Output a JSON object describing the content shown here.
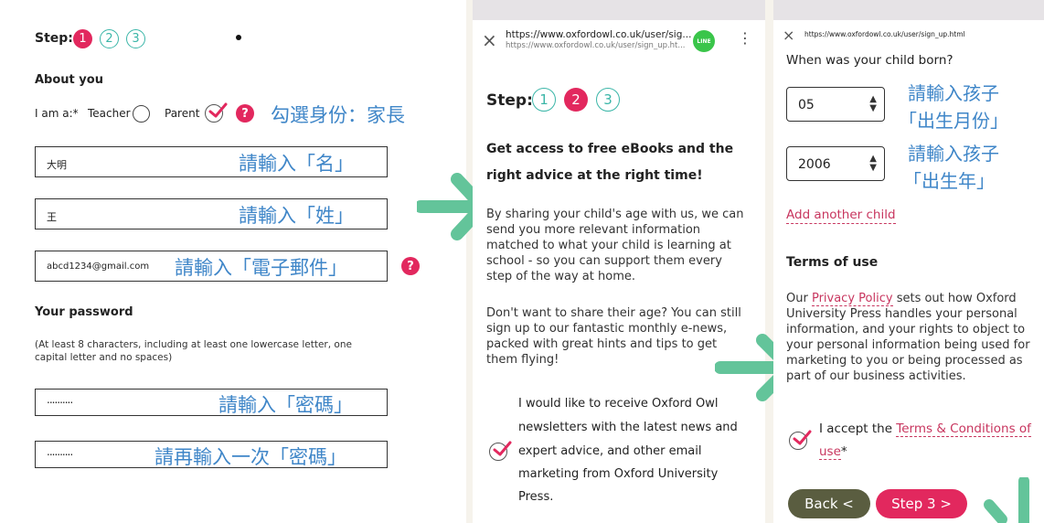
{
  "panel1": {
    "step_label": "Step:",
    "steps": [
      "1",
      "2",
      "3"
    ],
    "about_heading": "About you",
    "role_label": "I am a:*",
    "teacher_label": "Teacher",
    "parent_label": "Parent",
    "role_hint": "勾選身份：家長",
    "first_name_value": "大明",
    "first_name_hint": "請輸入「名」",
    "last_name_value": "王",
    "last_name_hint": "請輸入「姓」",
    "email_value": "abcd1234@gmail.com",
    "email_hint": "請輸入「電子郵件」",
    "password_heading": "Your password",
    "password_rules": "(At least 8 characters, including at least one lowercase letter, one capital letter and no spaces)",
    "password_value": "..........",
    "password_hint": "請輸入「密碼」",
    "password_confirm_value": "..........",
    "password_confirm_hint": "請再輸入一次「密碼」"
  },
  "panel2": {
    "url_main": "https://www.oxfordowl.co.uk/user/sig...",
    "url_sub": "https://www.oxfordowl.co.uk/user/sign_up.ht...",
    "line_badge": "LINE",
    "step_label": "Step:",
    "steps": [
      "1",
      "2",
      "3"
    ],
    "heading_line1": "Get access to free eBooks and the",
    "heading_line2": "right advice at the right time!",
    "para1": "By sharing your child's age with us, we can send you more relevant information matched to what your child is learning at school - so you can support them every step of the way at home.",
    "para2": "Don't want to share their age? You can still sign up to our fantastic monthly e-news, packed with great hints and tips to get them flying!",
    "newsletter_lines": [
      "I would like to receive Oxford Owl",
      "newsletters with the latest news and",
      "expert advice, and other email",
      "marketing from Oxford University",
      "Press."
    ]
  },
  "panel3": {
    "url": "https://www.oxfordowl.co.uk/user/sign_up.html",
    "born_question": "When was your child born?",
    "month_value": "05",
    "month_hint_1": "請輸入孩子",
    "month_hint_2": "「出生月份」",
    "year_value": "2006",
    "year_hint_1": "請輸入孩子",
    "year_hint_2": "「出生年」",
    "add_child": "Add another child",
    "terms_heading": "Terms of use",
    "terms_para_pre": "Our ",
    "terms_para_link": "Privacy Policy",
    "terms_para_post": " sets out how Oxford University Press handles your personal information, and your rights to object to your personal information being used for marketing to you or being processed as part of our business activities.",
    "accept_pre": "I accept the ",
    "accept_link_1": "Terms & Conditions of",
    "accept_link_2": "use",
    "accept_star": "*",
    "back_button": "Back  <",
    "next_button": "Step 3  >"
  },
  "colors": {
    "accent": "#e2285e",
    "teal": "#3bb6a8",
    "hint_blue": "#3f86c8",
    "arrow_green": "#63c49a"
  }
}
